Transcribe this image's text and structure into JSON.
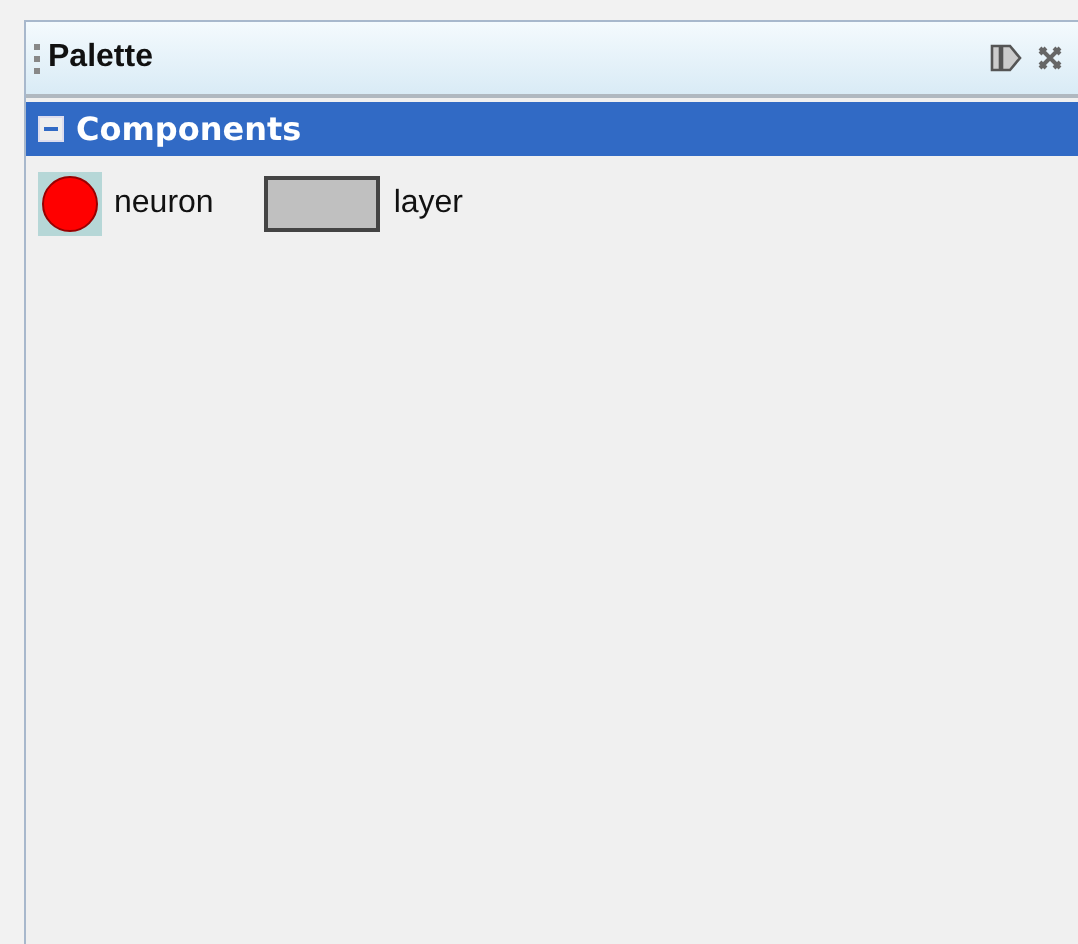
{
  "window": {
    "title": "Palette"
  },
  "categories": [
    {
      "label": "Components",
      "expanded": true,
      "items": [
        {
          "label": "neuron",
          "kind": "circle",
          "selected": true
        },
        {
          "label": "layer",
          "kind": "rect",
          "selected": false
        }
      ]
    }
  ]
}
